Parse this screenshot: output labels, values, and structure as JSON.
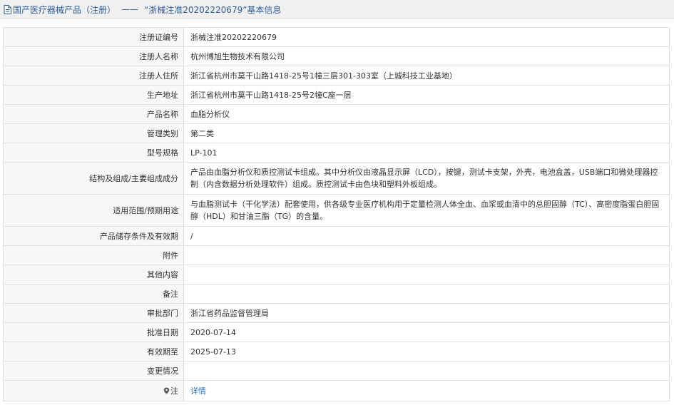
{
  "header": {
    "category": "国产医疗器械产品（注册）",
    "separator": "——",
    "record_title": "“浙械注准20202220679”基本信息"
  },
  "rows": [
    {
      "label": "注册证编号",
      "value": "浙械注准20202220679"
    },
    {
      "label": "注册人名称",
      "value": "杭州博旭生物技术有限公司"
    },
    {
      "label": "注册人住所",
      "value": "浙江省杭州市莫干山路1418-25号1幢三层301-303室（上城科技工业基地）"
    },
    {
      "label": "生产地址",
      "value": "浙江省杭州市莫干山路1418-25号2幢C座一层"
    },
    {
      "label": "产品名称",
      "value": "血脂分析仪"
    },
    {
      "label": "管理类别",
      "value": "第二类"
    },
    {
      "label": "型号规格",
      "value": "LP-101"
    },
    {
      "label": "结构及组成/主要组成成分",
      "value": "产品由血脂分析仪和质控测试卡组成。其中分析仪由液晶显示屏（LCD），按键，测试卡支架，外壳，电池盒盖，USB端口和微处理器控制（内含数据分析处理软件）组成。质控测试卡由色块和塑料外板组成。"
    },
    {
      "label": "适用范围/预期用途",
      "value": "与血脂测试卡（干化学法）配套使用，供各级专业医疗机构用于定量检测人体全血、血浆或血清中的总胆固醇（TC）、高密度脂蛋白胆固醇（HDL）和甘油三酯（TG）的含量。"
    },
    {
      "label": "产品储存条件及有效期",
      "value": "/"
    },
    {
      "label": "附件",
      "value": ""
    },
    {
      "label": "其他内容",
      "value": ""
    },
    {
      "label": "备注",
      "value": ""
    },
    {
      "label": "审批部门",
      "value": "浙江省药品监督管理局"
    },
    {
      "label": "批准日期",
      "value": "2020-07-14"
    },
    {
      "label": "有效期至",
      "value": "2025-07-13"
    },
    {
      "label": "变更情况",
      "value": ""
    }
  ],
  "note_row": {
    "icon": "pin-icon",
    "label": "注",
    "link_text": "详情"
  }
}
